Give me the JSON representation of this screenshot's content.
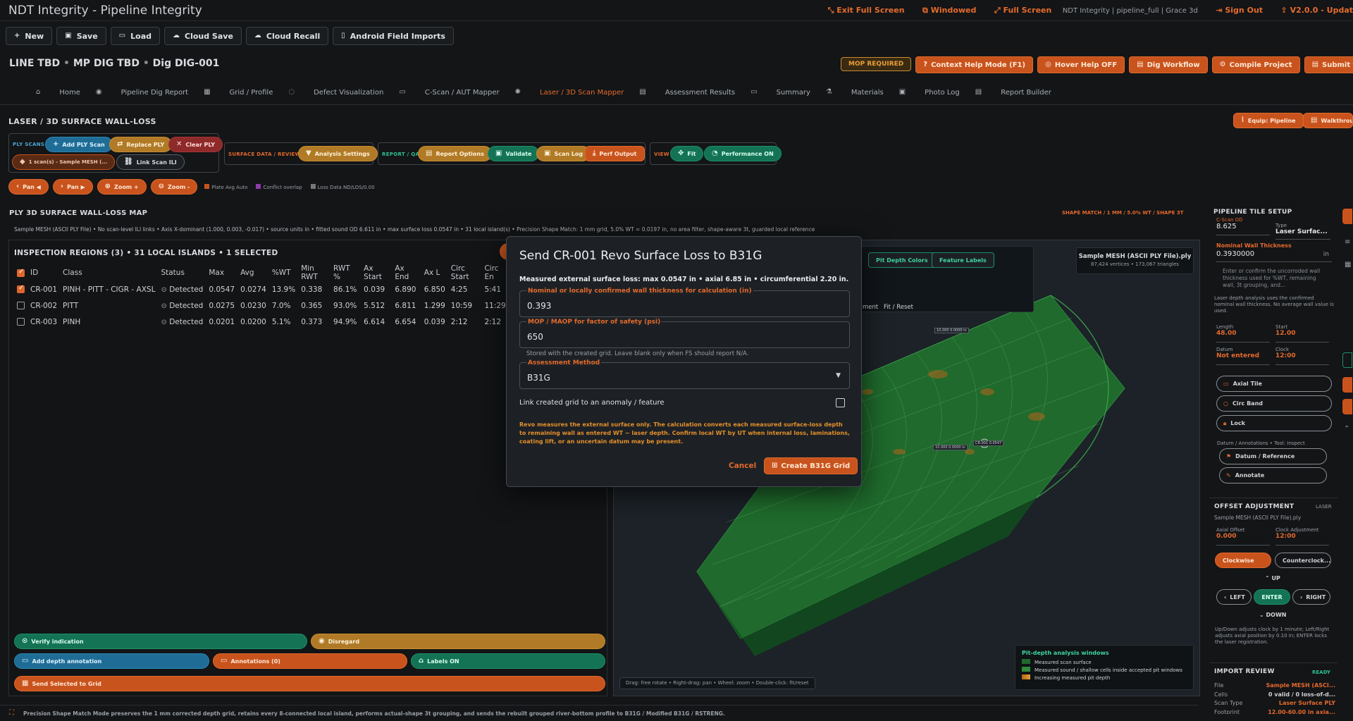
{
  "app": {
    "title": "NDT Integrity - Pipeline Integrity"
  },
  "topbar": {
    "exit_full_screen": "Exit Full Screen",
    "windowed": "Windowed",
    "full_screen": "Full Screen",
    "info": "NDT Integrity | pipeline_full | Grace 3d",
    "sign_out": "Sign Out",
    "version": "V2.0.0 - Updat"
  },
  "toolbar": {
    "new": "New",
    "save": "Save",
    "load": "Load",
    "cloud_save": "Cloud Save",
    "cloud_recall": "Cloud Recall",
    "android": "Android Field Imports"
  },
  "breadcrumb": {
    "line": "LINE TBD",
    "dig": "MP DIG TBD",
    "digid": "Dig DIG-001"
  },
  "header_buttons": {
    "mop": "MOP REQUIRED",
    "context_help": "Context Help Mode (F1)",
    "hover_help": "Hover Help OFF",
    "dig_workflow": "Dig Workflow",
    "compile": "Compile Project",
    "submit": "Submit for Review"
  },
  "tabs": [
    "Home",
    "Pipeline Dig Report",
    "Grid / Profile",
    "Defect Visualization",
    "C-Scan / AUT Mapper",
    "Laser / 3D Scan Mapper",
    "Assessment Results",
    "Summary",
    "Materials",
    "Photo Log",
    "Report Builder"
  ],
  "page": {
    "title": "LASER / 3D SURFACE WALL-LOSS",
    "equip": "Equip: Pipeline",
    "walkthrough": "Walkthrough"
  },
  "ply_scans": {
    "label": "PLY SCANS",
    "add": "Add PLY Scan",
    "replace": "Replace PLY",
    "clear": "Clear PLY",
    "scan_sel": "1 scan(s) - Sample MESH (...",
    "link": "Link Scan ILI"
  },
  "surface": {
    "label": "SURFACE DATA / REVIEW",
    "analysis": "Analysis Settings"
  },
  "report_qa": {
    "label": "REPORT / QA",
    "options": "Report Options",
    "validate": "Validate",
    "scan_log": "Scan Log",
    "perf": "Perf Output"
  },
  "view": {
    "label": "VIEW",
    "fit": "Fit",
    "performance": "Performance ON"
  },
  "nav": {
    "pan_left": "Pan ◀",
    "pan_right": "Pan ▶",
    "zoom_in": "Zoom +",
    "zoom_out": "Zoom -",
    "plate_avg": "Plate Avg Auto",
    "conflict": "Conflict overlap",
    "loss_data": "Loss Data ND/LOS/0.00"
  },
  "map": {
    "title": "PLY 3D SURFACE WALL-LOSS MAP",
    "shape_match": "SHAPE MATCH / 1 MM / 5.0% WT / SHAPE 3T",
    "info": "Sample MESH (ASCII PLY File) • No scan-level ILI links • Axis X-dominant (1.000, 0.003, -0.017) • source units in • fitted sound OD 6.611 in • max surface loss 0.0547 in • 31 local island(s) • Precision Shape Match: 1 mm grid, 5.0% WT = 0.0197 in, no area filter, shape-aware 3t, guarded local reference"
  },
  "regions": {
    "title": "INSPECTION REGIONS (3) • 31 LOCAL ISLANDS • 1 SELECTED",
    "columns": [
      "ID",
      "Class",
      "Status",
      "Max",
      "Avg",
      "%WT",
      "Min RWT",
      "RWT %",
      "Ax Start",
      "Ax End",
      "Ax L",
      "Circ Start",
      "Circ En"
    ],
    "rows": [
      {
        "id": "CR-001",
        "class": "PINH - PITT - CIGR - AXSL",
        "status": "Detected",
        "max": "0.0547",
        "avg": "0.0274",
        "wt": "13.9%",
        "minrwt": "0.338",
        "rwtp": "86.1%",
        "axs": "0.039",
        "axe": "6.890",
        "axl": "6.850",
        "cs": "4:25",
        "ce": "5:41",
        "checked": true
      },
      {
        "id": "CR-002",
        "class": "PITT",
        "status": "Detected",
        "max": "0.0275",
        "avg": "0.0230",
        "wt": "7.0%",
        "minrwt": "0.365",
        "rwtp": "93.0%",
        "axs": "5.512",
        "axe": "6.811",
        "axl": "1.299",
        "cs": "10:59",
        "ce": "11:29",
        "checked": false
      },
      {
        "id": "CR-003",
        "class": "PINH",
        "status": "Detected",
        "max": "0.0201",
        "avg": "0.0200",
        "wt": "5.1%",
        "minrwt": "0.373",
        "rwtp": "94.9%",
        "axs": "6.614",
        "axe": "6.654",
        "axl": "0.039",
        "cs": "2:12",
        "ce": "2:12",
        "checked": false
      }
    ]
  },
  "actions": {
    "verify": "Verify indication",
    "disregard": "Disregard",
    "add_depth": "Add depth annotation",
    "annotations": "Annotations (0)",
    "labels": "Labels ON",
    "send_grid": "Send Selected to Grid"
  },
  "viewer": {
    "pit_colors": "Pit Depth Colors",
    "feature_labels": "Feature Labels",
    "ment": "ment",
    "fit_reset": "Fit / Reset",
    "mesh_title": "Sample MESH (ASCII PLY File).ply",
    "mesh_stats": "87,424 vertices • 173,067 triangles",
    "hint": "Drag: free rotate • Right-drag: pan • Wheel: zoom • Double-click: fit/reset",
    "legend_title": "Pit-depth analysis windows",
    "legend": [
      "Measured scan surface",
      "Measured sound / shallow cells inside accepted pit windows",
      "Increasing measured pit depth"
    ],
    "tag1": "10.000 0.0000 in",
    "tag2": "10.000 0.0000 in",
    "tag3": "CR-001 0.0547"
  },
  "modal": {
    "title": "Send CR-001 Revo Surface Loss to B31G",
    "summary": "Measured external surface loss: max 0.0547 in • axial 6.85 in • circumferential 2.20 in.",
    "wt_label": "Nominal or locally confirmed wall thickness for calculation (in)",
    "wt_value": "0.393",
    "mop_label": "MOP / MAOP for factor of safety (psi)",
    "mop_value": "650",
    "mop_hint": "Stored with the created grid. Leave blank only when FS should report N/A.",
    "method_label": "Assessment Method",
    "method_value": "B31G",
    "link_label": "Link created grid to an anomaly / feature",
    "warning": "Revo measures the external surface only. The calculation converts each measured surface-loss depth to remaining wall as entered WT − laser depth. Confirm local WT by UT when internal loss, laminations, coating lift, or an uncertain datum may be present.",
    "cancel": "Cancel",
    "create": "Create B31G Grid"
  },
  "right": {
    "tile_title": "PIPELINE TILE SETUP",
    "cscan_od_label": "C-Scan OD",
    "cscan_od": "8.625",
    "type_label": "Type",
    "type": "Laser Surfac...",
    "nwt_label": "Nominal Wall Thickness",
    "nwt": "0.3930000",
    "nwt_unit": "in",
    "nwt_help": "Enter or confirm the uncorroded wall thickness used for %WT, remaining wall, 3t grouping, and...",
    "laser_note": "Laser depth analysis uses the confirmed nominal wall thickness. No average wall value is used.",
    "length_label": "Length",
    "length": "48.00",
    "start_label": "Start",
    "start": "12.00",
    "datum_label": "Datum",
    "datum": "Not entered",
    "clock_label": "Clock",
    "clock": "12:00",
    "in": "in",
    "axial_tile": "Axial Tile",
    "circ_band": "Circ Band",
    "lock": "Lock",
    "datum_ann": "Datum / Annotations • Tool: Inspect",
    "datum_ref": "Datum / Reference",
    "annotate": "Annotate",
    "offset_title": "OFFSET ADJUSTMENT",
    "laser": "LASER",
    "offset_file": "Sample MESH (ASCII PLY File).ply",
    "axial_offset_label": "Axial Offset",
    "axial_offset": "0.000",
    "clock_adj_label": "Clock Adjustment",
    "clock_adj": "12:00",
    "clockwise": "Clockwise",
    "counter": "Counterclock...",
    "up": "UP",
    "left": "LEFT",
    "enter": "ENTER",
    "right": "RIGHT",
    "down": "DOWN",
    "offset_help": "Up/Down adjusts clock by 1 minute; Left/Right adjusts axial position by 0.10 in; ENTER locks the laser registration.",
    "import_title": "IMPORT REVIEW",
    "ready": "READY",
    "file_label": "File",
    "file": "Sample MESH (ASCI...",
    "cells_label": "Cells",
    "cells": "0 valid / 0 loss-of-d...",
    "scan_type_label": "Scan Type",
    "scan_type": "Laser Surface PLY",
    "footprint_label": "Footprint",
    "footprint": "12.00-60.00 in axia..."
  },
  "status": {
    "text": "Precision Shape Match Mode preserves the 1 mm corrected depth grid, retains every 8-connected local island, performs actual-shape 3t grouping, and sends the rebuilt grouped river-bottom profile to B31G / Modified B31G / RSTRENG."
  },
  "colors": {
    "accent": "#e5692c",
    "teal": "#137354",
    "amber": "#b07a26",
    "blue": "#1f6d96"
  }
}
